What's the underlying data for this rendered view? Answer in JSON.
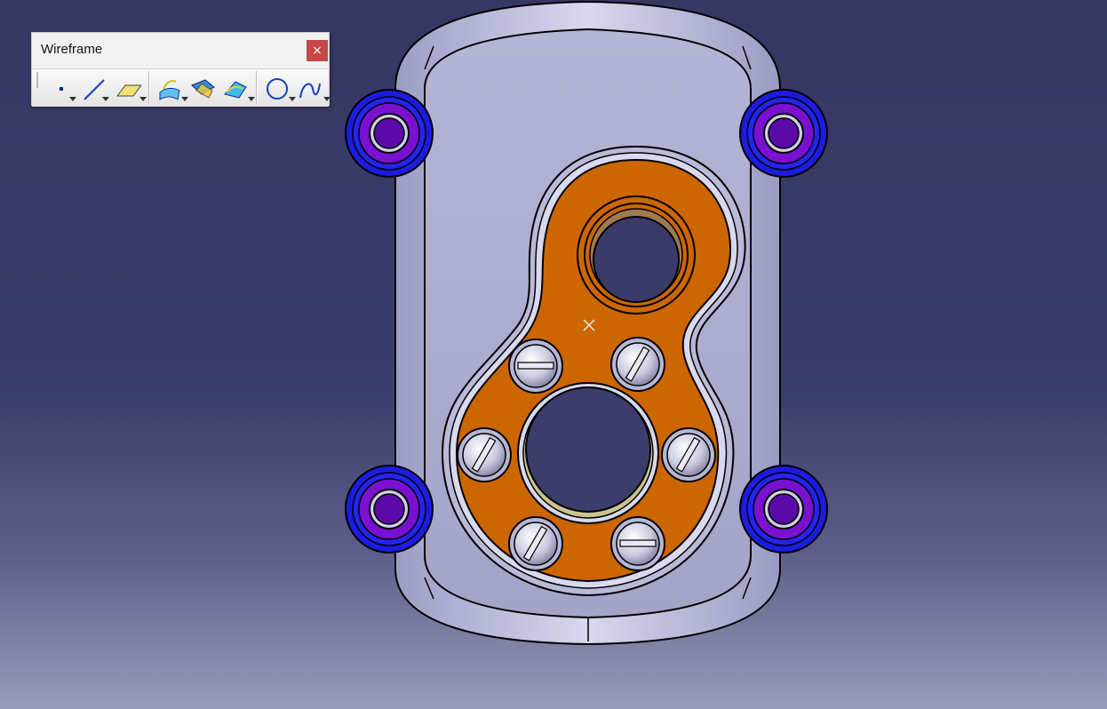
{
  "toolbar": {
    "title": "Wireframe",
    "close_label": "×",
    "buttons": [
      {
        "name": "point",
        "icon": "point-icon"
      },
      {
        "name": "line",
        "icon": "line-icon"
      },
      {
        "name": "plane",
        "icon": "plane-icon"
      },
      {
        "name": "projection",
        "icon": "projection-icon"
      },
      {
        "name": "intersection",
        "icon": "intersection-icon"
      },
      {
        "name": "parallel-curve",
        "icon": "parallel-curve-icon"
      },
      {
        "name": "circle",
        "icon": "circle-icon"
      },
      {
        "name": "spline",
        "icon": "spline-icon"
      }
    ]
  },
  "viewport": {
    "background_top": "#363763",
    "background_bottom": "#9a9bba",
    "part_body_color": "#a8a9cc",
    "cover_color": "#cc6600",
    "boss_color": "#2020d8",
    "boss_inner_color": "#7a10d0"
  }
}
